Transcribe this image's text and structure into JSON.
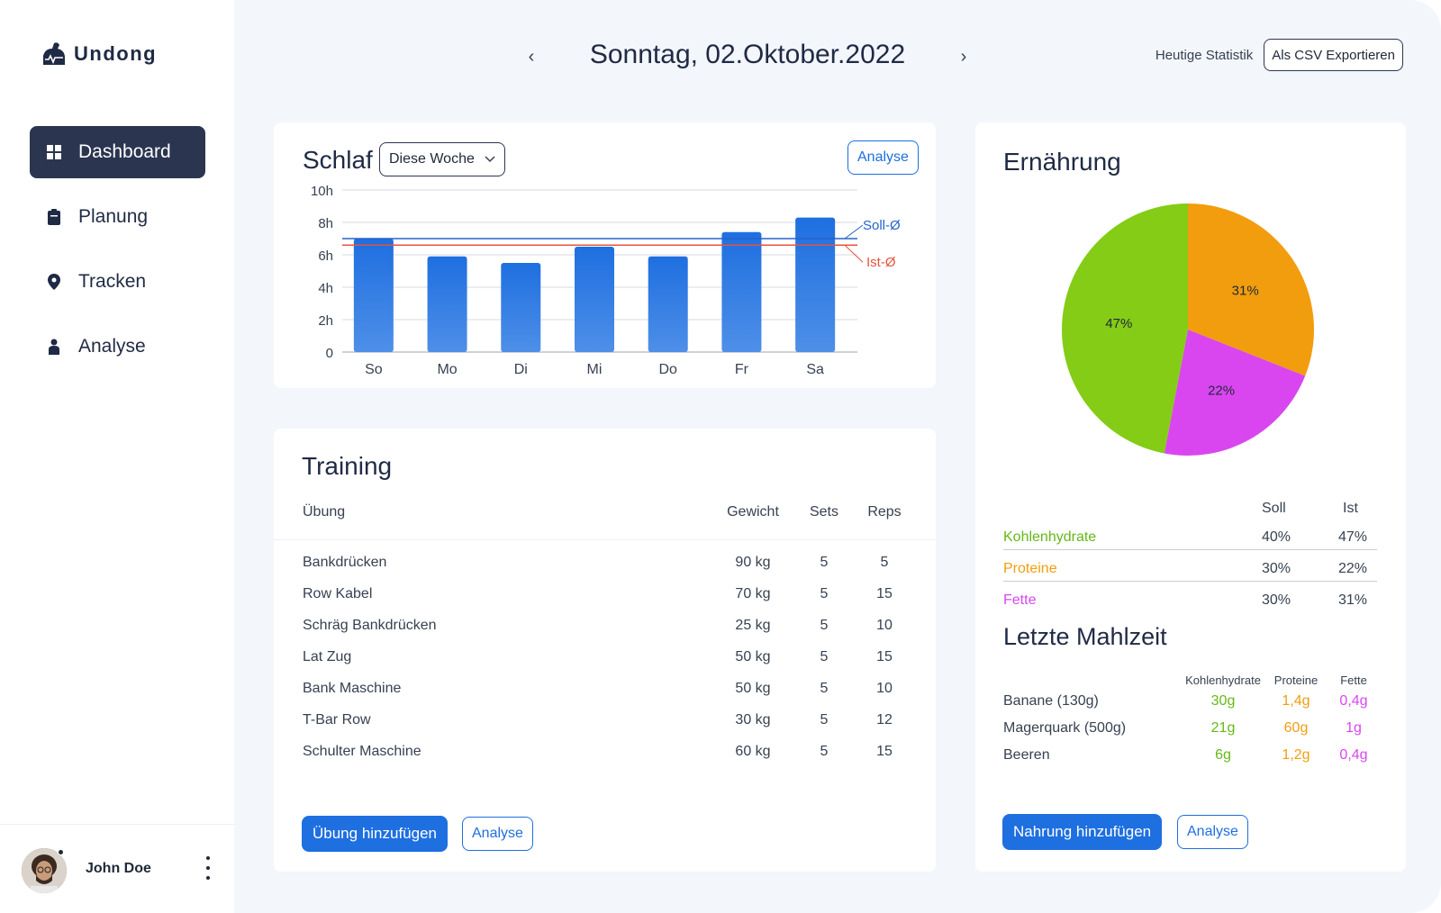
{
  "brand": {
    "name": "Undong"
  },
  "nav": [
    {
      "label": "Dashboard",
      "icon": "grid-icon",
      "active": true
    },
    {
      "label": "Planung",
      "icon": "clipboard-icon",
      "active": false
    },
    {
      "label": "Tracken",
      "icon": "location-pin-icon",
      "active": false
    },
    {
      "label": "Analyse",
      "icon": "person-icon",
      "active": false
    }
  ],
  "user": {
    "name": "John Doe"
  },
  "header": {
    "date": "Sonntag, 02.Oktober.2022",
    "prev_icon": "chevron-left-icon",
    "next_icon": "chevron-right-icon",
    "stats_label": "Heutige Statistik",
    "export_label": "Als CSV Exportieren"
  },
  "sleep": {
    "title": "Schlaf",
    "range_select": "Diese Woche",
    "analyse_label": "Analyse"
  },
  "chart_data": {
    "type": "bar",
    "categories": [
      "So",
      "Mo",
      "Di",
      "Mi",
      "Do",
      "Fr",
      "Sa"
    ],
    "values": [
      7.0,
      5.9,
      5.5,
      6.5,
      5.9,
      7.4,
      8.3
    ],
    "ylim": [
      0,
      10
    ],
    "yticks": [
      "0",
      "2h",
      "4h",
      "6h",
      "8h",
      "10h"
    ],
    "ytick_values": [
      0,
      2,
      4,
      6,
      8,
      10
    ],
    "reference_lines": [
      {
        "name": "Soll-Ø",
        "value": 7.0,
        "color": "#2563c9"
      },
      {
        "name": "Ist-Ø",
        "value": 6.6,
        "color": "#e5533d"
      }
    ],
    "bar_color": "#1e6fe0",
    "grid": true
  },
  "training": {
    "title": "Training",
    "columns": [
      "Übung",
      "Gewicht",
      "Sets",
      "Reps"
    ],
    "rows": [
      [
        "Bankdrücken",
        "90 kg",
        "5",
        "5"
      ],
      [
        "Row Kabel",
        "70 kg",
        "5",
        "15"
      ],
      [
        "Schräg Bankdrücken",
        "25 kg",
        "5",
        "10"
      ],
      [
        "Lat Zug",
        "50 kg",
        "5",
        "15"
      ],
      [
        "Bank Maschine",
        "50 kg",
        "5",
        "10"
      ],
      [
        "T-Bar Row",
        "30 kg",
        "5",
        "12"
      ],
      [
        "Schulter Maschine",
        "60 kg",
        "5",
        "15"
      ]
    ],
    "add_label": "Übung hinzufügen",
    "analyse_label": "Analyse"
  },
  "nutrition": {
    "title": "Ernährung",
    "pie": [
      {
        "name": "Fette",
        "value": 31,
        "label": "31%",
        "color": "#f29d0e"
      },
      {
        "name": "Proteine",
        "value": 22,
        "label": "22%",
        "color": "#d946ef"
      },
      {
        "name": "Kohlenhydrate",
        "value": 47,
        "label": "47%",
        "color": "#84cc16"
      }
    ],
    "table_head": {
      "soll": "Soll",
      "ist": "Ist"
    },
    "table": [
      {
        "name": "Kohlenhydrate",
        "soll": "40%",
        "ist": "47%",
        "color": "#65b817"
      },
      {
        "name": "Proteine",
        "soll": "30%",
        "ist": "22%",
        "color": "#f29d0e"
      },
      {
        "name": "Fette",
        "soll": "30%",
        "ist": "31%",
        "color": "#d946ef"
      }
    ],
    "meal_title": "Letzte Mahlzeit",
    "meal_columns": [
      "Kohlenhydrate",
      "Proteine",
      "Fette"
    ],
    "meals": [
      {
        "name": "Banane (130g)",
        "carbs": "30g",
        "protein": "1,4g",
        "fat": "0,4g"
      },
      {
        "name": "Magerquark (500g)",
        "carbs": "21g",
        "protein": "60g",
        "fat": "1g"
      },
      {
        "name": "Beeren",
        "carbs": "6g",
        "protein": "1,2g",
        "fat": "0,4g"
      }
    ],
    "add_label": "Nahrung hinzufügen",
    "analyse_label": "Analyse"
  }
}
